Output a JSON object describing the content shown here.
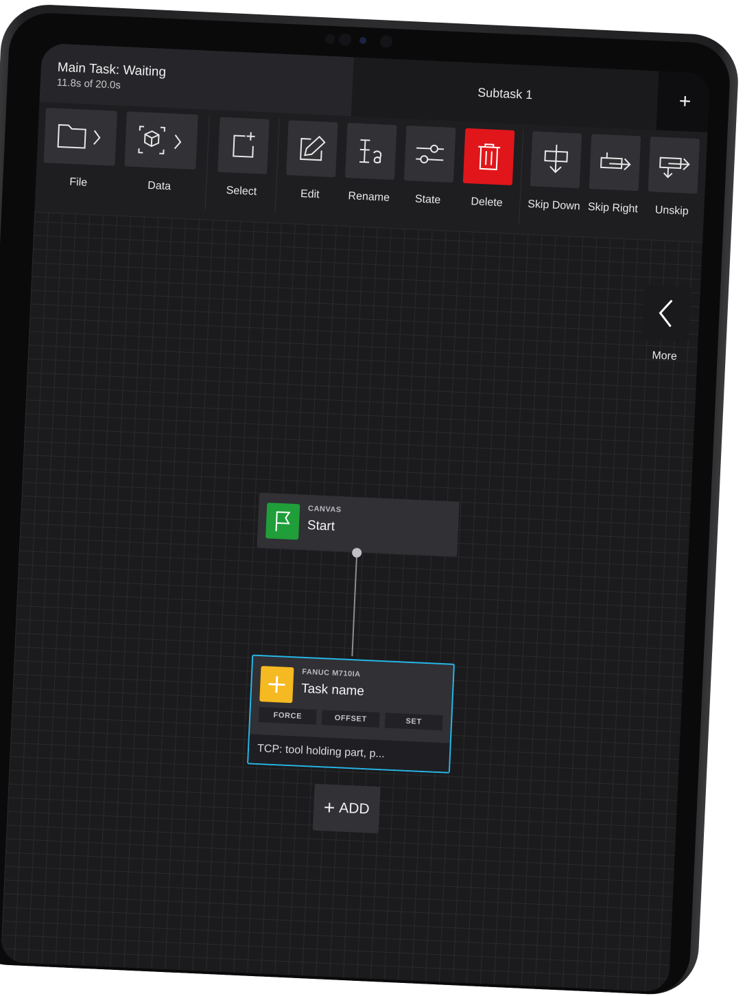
{
  "status": {
    "title": "Main Task: Waiting",
    "progress": "11.8s of 20.0s"
  },
  "tabs": {
    "subtask": "Subtask 1",
    "add": "+"
  },
  "toolbar": {
    "file": "File",
    "data": "Data",
    "select": "Select",
    "edit": "Edit",
    "rename": "Rename",
    "state": "State",
    "delete": "Delete",
    "skip_down": "Skip Down",
    "skip_right": "Skip Right",
    "unskip": "Unskip",
    "more": "More"
  },
  "canvas": {
    "start_node": {
      "caption": "CANVAS",
      "name": "Start",
      "icon": "flag-icon",
      "color": "#1f9e3a"
    },
    "task_node": {
      "caption": "FANUC M710IA",
      "name": "Task name",
      "icon": "plus-icon",
      "color": "#f5b921",
      "tags": [
        "FORCE",
        "OFFSET",
        "SET"
      ],
      "footer": "TCP: tool holding part, p..."
    },
    "add_button": {
      "plus": "+",
      "label": "ADD"
    }
  },
  "colors": {
    "accent": "#26b7e8",
    "danger": "#e0161b"
  }
}
